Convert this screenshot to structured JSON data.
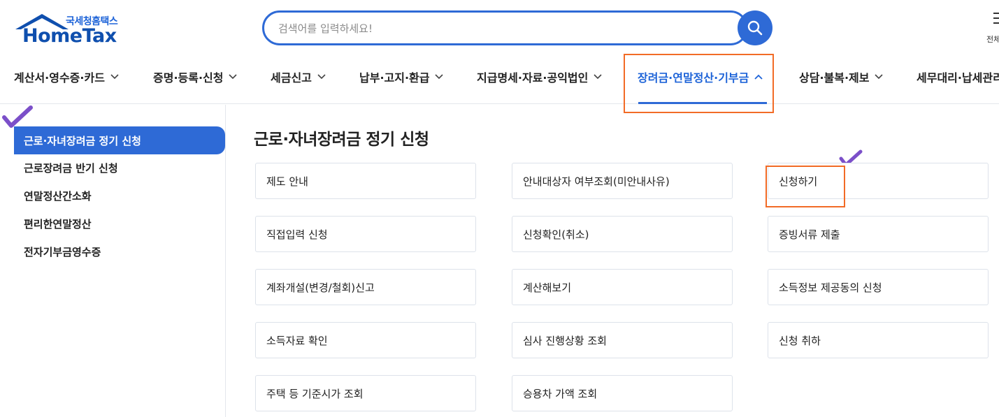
{
  "header": {
    "logo_sub": "국세청홈택스",
    "logo_main": "HomeTax",
    "search_placeholder": "검색어를 입력하세요!",
    "all_menu_label": "전체메뉴"
  },
  "nav": {
    "items": [
      {
        "label": "계산서·영수증·카드"
      },
      {
        "label": "증명·등록·신청"
      },
      {
        "label": "세금신고"
      },
      {
        "label": "납부·고지·환급"
      },
      {
        "label": "지급명세·자료·공익법인"
      },
      {
        "label": "장려금·연말정산·기부금",
        "active": true
      },
      {
        "label": "상담·불복·제보"
      },
      {
        "label": "세무대리·납세관리"
      }
    ]
  },
  "sidebar": {
    "items": [
      {
        "label": "근로·자녀장려금 정기 신청",
        "active": true
      },
      {
        "label": "근로장려금 반기 신청"
      },
      {
        "label": "연말정산간소화"
      },
      {
        "label": "편리한연말정산"
      },
      {
        "label": "전자기부금영수증"
      }
    ]
  },
  "main": {
    "title": "근로·자녀장려금 정기 신청",
    "cards": [
      "제도 안내",
      "안내대상자 여부조회(미안내사유)",
      "신청하기",
      "직접입력 신청",
      "신청확인(취소)",
      "증빙서류 제출",
      "계좌개설(변경/철회)신고",
      "계산해보기",
      "소득정보 제공동의 신청",
      "소득자료 확인",
      "심사 진행상황 조회",
      "신청 취하",
      "주택 등 기준시가 조회",
      "승용차 가액 조회"
    ]
  },
  "colors": {
    "accent": "#2e6ad6",
    "brand_dark": "#0f4fae",
    "highlight": "#f26b26",
    "checkmark": "#7b4fc9"
  }
}
